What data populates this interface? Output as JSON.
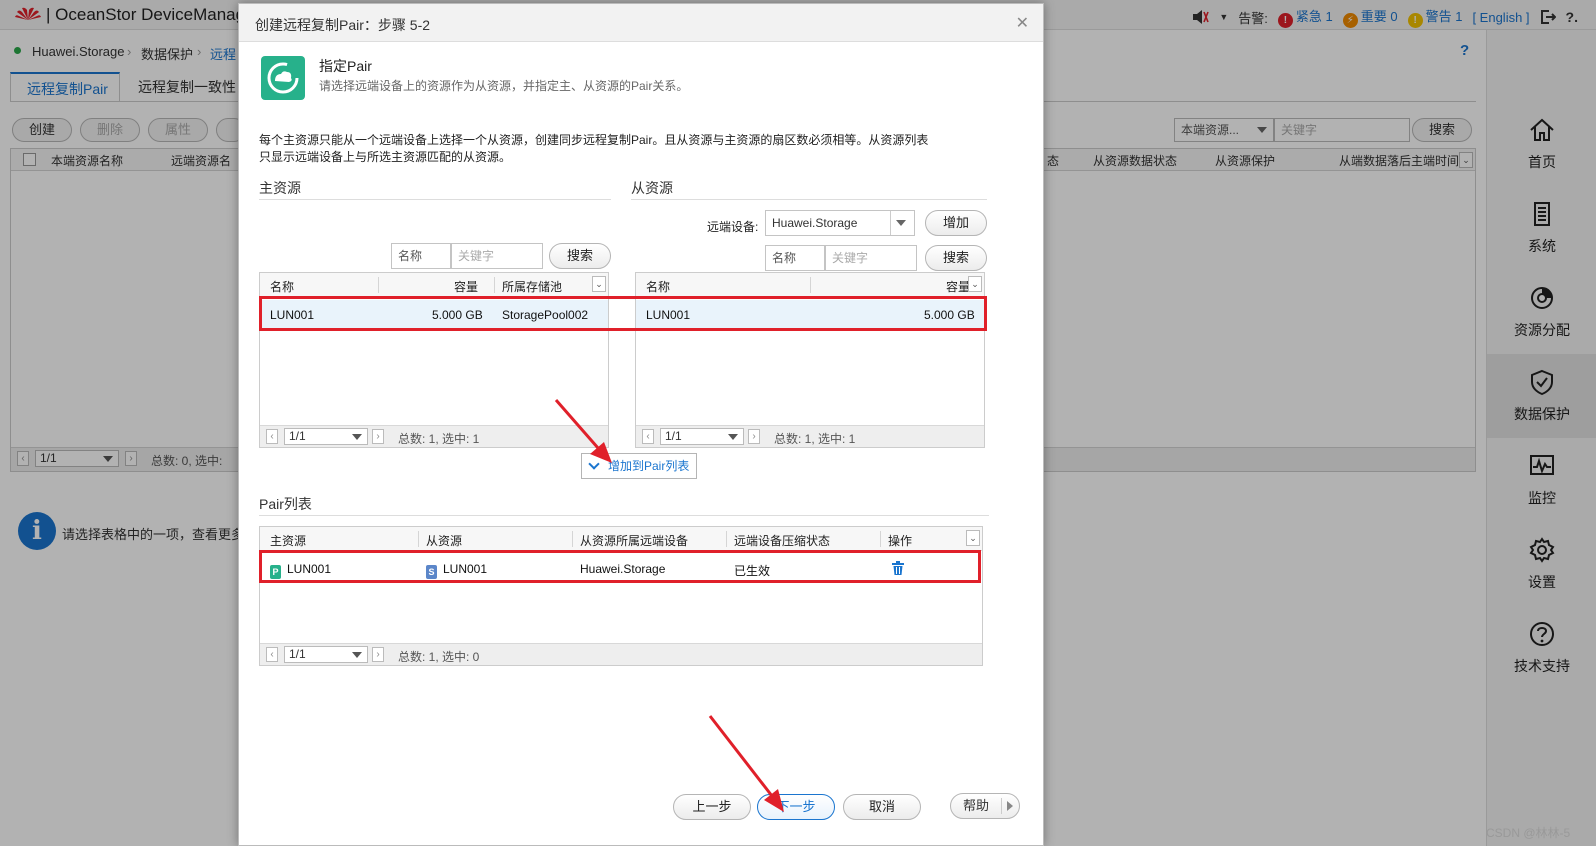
{
  "app": {
    "title": "OceanStor DeviceManag",
    "alarm_label": "告警:",
    "urgent": "紧急 1",
    "major": "重要 0",
    "warning": "警告 1",
    "language": "[ English ]",
    "help": "?"
  },
  "breadcrumb": {
    "device": "Huawei.Storage",
    "section": "数据保护",
    "current": "远程"
  },
  "tabs": [
    {
      "label": "远程复制Pair"
    },
    {
      "label": "远程复制一致性"
    }
  ],
  "toolbar": {
    "create": "创建",
    "delete": "删除",
    "properties": "属性",
    "filter": "本端资源...",
    "keyword_placeholder": "关键字",
    "search": "搜索"
  },
  "bg_table": {
    "columns": [
      "本端资源名称",
      "远端资源名",
      "态",
      "从资源数据状态",
      "从资源保护",
      "从端数据落后主端时间"
    ],
    "page": "1/1",
    "summary": "总数: 0, 选中:"
  },
  "info": {
    "text": "请选择表格中的一项，查看更多"
  },
  "nav": [
    {
      "label": "首页",
      "icon": "home-icon"
    },
    {
      "label": "系统",
      "icon": "system-icon"
    },
    {
      "label": "资源分配",
      "icon": "resource-icon"
    },
    {
      "label": "数据保护",
      "icon": "shield-icon"
    },
    {
      "label": "监控",
      "icon": "monitor-icon"
    },
    {
      "label": "设置",
      "icon": "gear-icon"
    },
    {
      "label": "技术支持",
      "icon": "support-icon"
    }
  ],
  "modal": {
    "title": "创建远程复制Pair：步骤 5-2",
    "step_title": "指定Pair",
    "step_subtitle": "请选择远端设备上的资源作为从资源，并指定主、从资源的Pair关系。",
    "description_line1": "每个主资源只能从一个远端设备上选择一个从资源，创建同步远程复制Pair。且从资源与主资源的扇区数必须相等。从资源列表",
    "description_line2": "只显示远端设备上与所选主资源匹配的从资源。",
    "primary": {
      "title": "主资源",
      "name_label": "名称",
      "keyword_placeholder": "关键字",
      "search": "搜索",
      "columns": [
        "名称",
        "容量",
        "所属存储池"
      ],
      "rows": [
        {
          "name": "LUN001",
          "capacity": "5.000 GB",
          "pool": "StoragePool002"
        }
      ],
      "page": "1/1",
      "summary": "总数: 1, 选中: 1"
    },
    "secondary": {
      "title": "从资源",
      "remote_label": "远端设备:",
      "remote_value": "Huawei.Storage",
      "add": "增加",
      "name_label": "名称",
      "keyword_placeholder": "关键字",
      "search": "搜索",
      "columns": [
        "名称",
        "容量"
      ],
      "rows": [
        {
          "name": "LUN001",
          "capacity": "5.000 GB"
        }
      ],
      "page": "1/1",
      "summary": "总数: 1, 选中: 1"
    },
    "add_to_pair": "增加到Pair列表",
    "pair": {
      "title": "Pair列表",
      "columns": [
        "主资源",
        "从资源",
        "从资源所属远端设备",
        "远端设备压缩状态",
        "操作"
      ],
      "rows": [
        {
          "primary": "LUN001",
          "primary_badge": "P",
          "secondary": "LUN001",
          "secondary_badge": "S",
          "device": "Huawei.Storage",
          "compression": "已生效"
        }
      ],
      "page": "1/1",
      "summary": "总数: 1, 选中: 0"
    },
    "buttons": {
      "prev": "上一步",
      "next": "下一步",
      "cancel": "取消",
      "help": "帮助"
    }
  },
  "watermark": "CSDN @林林-5",
  "colors": {
    "accent": "#1a75cf",
    "highlight": "#e0202a",
    "step_icon": "#27b18b"
  }
}
